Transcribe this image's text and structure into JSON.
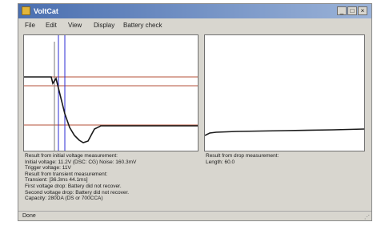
{
  "window": {
    "title": "VoltCat",
    "controls": {
      "minimize": "_",
      "maximize": "□",
      "close": "×"
    }
  },
  "menu": [
    "File",
    "Edit",
    "View",
    "Display",
    "Battery check"
  ],
  "left_chart": {
    "line_color": "#1a1a1a",
    "guide_color": "#b5523a",
    "cursor_color": "#2b2bd6",
    "marker_color": "#777777"
  },
  "right_chart": {
    "line_color": "#1a1a1a"
  },
  "left_info": [
    "Result from initial voltage measurement:",
    "Initial voltage: 11.2V (DSC: CG) Noise: 160.3mV",
    "Trigger voltage: 11V",
    "Result from transient measurement:",
    "Transient: [36.3ms 44.1ms]",
    "First voltage drop: Battery did not recover.",
    "Second voltage drop: Battery did not recover.",
    "Capacity: 280DA (DS or 700CCA)"
  ],
  "right_info": [
    "Result from drop measurement:",
    "Length: 60.0"
  ],
  "status": {
    "text": "Done",
    "grip": "⋰"
  }
}
